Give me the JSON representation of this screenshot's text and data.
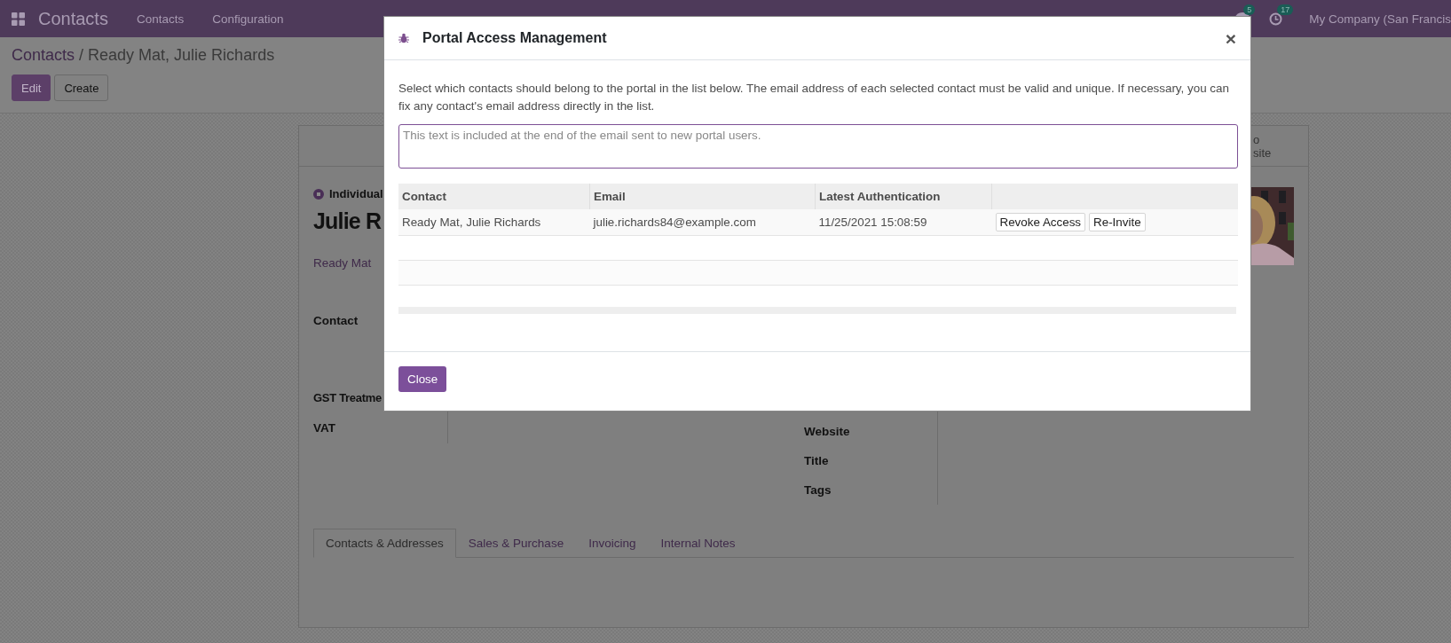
{
  "navbar": {
    "app_name": "Contacts",
    "menus": [
      "Contacts",
      "Configuration"
    ],
    "chat_badge": "5",
    "activity_badge": "17",
    "company": "My Company (San Francis"
  },
  "breadcrumb": {
    "parent": "Contacts",
    "separator": "/",
    "current": "Ready Mat, Julie Richards"
  },
  "actions": [
    {
      "label": "Edit",
      "kind": "primary"
    },
    {
      "label": "Create",
      "kind": "secondary"
    }
  ],
  "form": {
    "smart_button_lines": [
      "o",
      "site"
    ],
    "company_type": {
      "label": "Individual",
      "checked": true
    },
    "name": "Julie R",
    "company": "Ready Mat",
    "left_labels": [
      "Contact",
      "GST Treatme",
      "VAT"
    ],
    "right_labels": [
      "Website",
      "Title",
      "Tags"
    ],
    "tabs": [
      {
        "label": "Contacts & Addresses",
        "selected": true
      },
      {
        "label": "Sales & Purchase",
        "selected": false
      },
      {
        "label": "Invoicing",
        "selected": false
      },
      {
        "label": "Internal Notes",
        "selected": false
      }
    ]
  },
  "dialog": {
    "title": "Portal Access Management",
    "close_symbol": "×",
    "intro": "Select which contacts should belong to the portal in the list below. The email address of each selected contact must be valid and unique. If necessary, you can fix any contact's email address directly in the list.",
    "welcome_message": {
      "placeholder": "This text is included at the end of the email sent to new portal users."
    },
    "table": {
      "columns": [
        "Contact",
        "Email",
        "Latest Authentication"
      ],
      "rows": [
        {
          "contact": "Ready Mat, Julie Richards",
          "email": "julie.richards84@example.com",
          "latest_authentication": "11/25/2021 15:08:59",
          "buttons": [
            "Revoke Access",
            "Re-Invite"
          ]
        }
      ]
    },
    "footer_button": "Close"
  }
}
